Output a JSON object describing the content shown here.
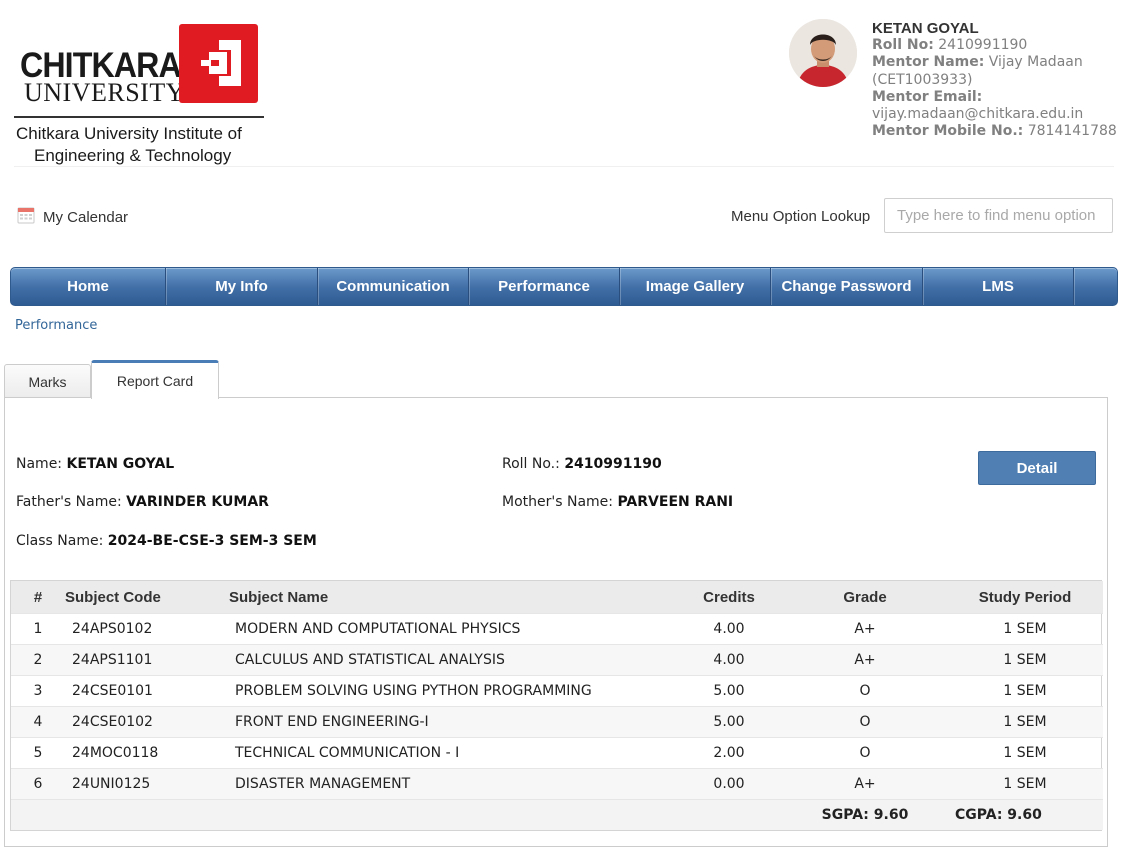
{
  "logo": {
    "wordmark_line1": "CHITKARA",
    "wordmark_line2": "UNIVERSITY",
    "institute_line1": "Chitkara University Institute of",
    "institute_line2": "Engineering & Technology"
  },
  "profile": {
    "name": "KETAN GOYAL",
    "roll_label": "Roll No:",
    "roll_value": "2410991190",
    "mentor_name_label": "Mentor Name:",
    "mentor_name_value": "Vijay Madaan (CET1003933)",
    "mentor_email_label": "Mentor Email:",
    "mentor_email_value": "vijay.madaan@chitkara.edu.in",
    "mentor_mobile_label": "Mentor Mobile No.:",
    "mentor_mobile_value": "7814141788"
  },
  "toolbar": {
    "calendar_label": "My Calendar",
    "lookup_label": "Menu Option Lookup",
    "lookup_placeholder": "Type here to find menu option"
  },
  "nav": {
    "items": [
      {
        "label": "Home"
      },
      {
        "label": "My Info"
      },
      {
        "label": "Communication"
      },
      {
        "label": "Performance"
      },
      {
        "label": "Image Gallery"
      },
      {
        "label": "Change Password"
      },
      {
        "label": "LMS"
      }
    ]
  },
  "breadcrumb": "Performance",
  "tabs": [
    {
      "label": "Marks"
    },
    {
      "label": "Report Card"
    }
  ],
  "student": {
    "name_label": "Name:",
    "name_value": "KETAN GOYAL",
    "roll_label": "Roll No.:",
    "roll_value": "2410991190",
    "father_label": "Father's Name:",
    "father_value": "VARINDER KUMAR",
    "mother_label": "Mother's Name:",
    "mother_value": "PARVEEN RANI",
    "class_label": "Class Name:",
    "class_value": "2024-BE-CSE-3 SEM-3 SEM",
    "detail_button": "Detail"
  },
  "grades": {
    "headers": {
      "num": "#",
      "code": "Subject Code",
      "name": "Subject Name",
      "credits": "Credits",
      "grade": "Grade",
      "period": "Study Period"
    },
    "rows": [
      {
        "num": "1",
        "code": "24APS0102",
        "name": "MODERN AND COMPUTATIONAL PHYSICS",
        "credits": "4.00",
        "grade": "A+",
        "period": "1 SEM"
      },
      {
        "num": "2",
        "code": "24APS1101",
        "name": "CALCULUS AND STATISTICAL ANALYSIS",
        "credits": "4.00",
        "grade": "A+",
        "period": "1 SEM"
      },
      {
        "num": "3",
        "code": "24CSE0101",
        "name": "PROBLEM SOLVING USING PYTHON PROGRAMMING",
        "credits": "5.00",
        "grade": "O",
        "period": "1 SEM"
      },
      {
        "num": "4",
        "code": "24CSE0102",
        "name": "FRONT END ENGINEERING-I",
        "credits": "5.00",
        "grade": "O",
        "period": "1 SEM"
      },
      {
        "num": "5",
        "code": "24MOC0118",
        "name": "TECHNICAL COMMUNICATION - I",
        "credits": "2.00",
        "grade": "O",
        "period": "1 SEM"
      },
      {
        "num": "6",
        "code": "24UNI0125",
        "name": "DISASTER MANAGEMENT",
        "credits": "0.00",
        "grade": "A+",
        "period": "1 SEM"
      }
    ],
    "sgpa": "SGPA: 9.60",
    "cgpa": "CGPA: 9.60"
  }
}
